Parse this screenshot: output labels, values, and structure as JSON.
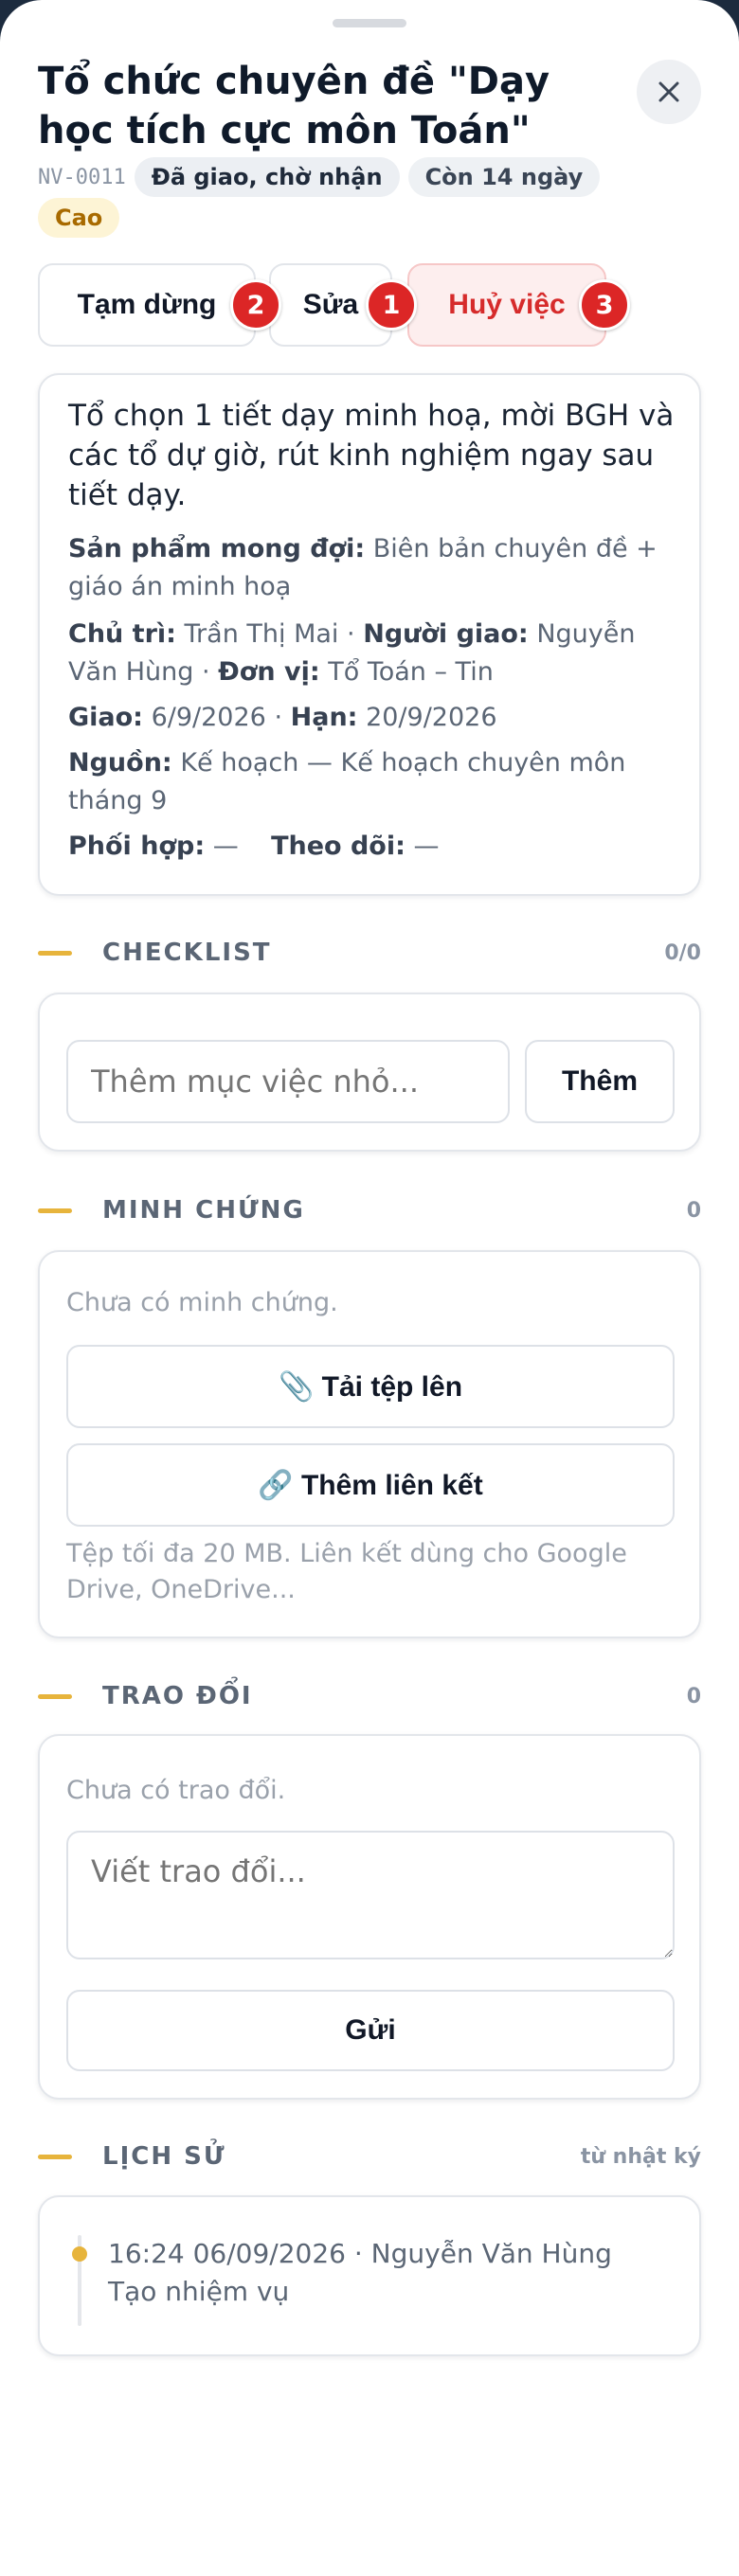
{
  "task": {
    "title": "Tổ chức chuyên đề \"Dạy học tích cực môn Toán\"",
    "code": "NV-0011",
    "status": "Đã giao, chờ nhận",
    "remaining": "Còn 14 ngày",
    "priority": "Cao"
  },
  "actions": {
    "pause": {
      "label": "Tạm dừng",
      "badge": "2"
    },
    "edit": {
      "label": "Sửa",
      "badge": "1"
    },
    "cancel": {
      "label": "Huỷ việc",
      "badge": "3"
    }
  },
  "details": {
    "description": "Tổ chọn 1 tiết dạy minh hoạ, mời BGH và các tổ dự giờ, rút kinh nghiệm ngay sau tiết dạy.",
    "product_label": "Sản phẩm mong đợi:",
    "product_value": "Biên bản chuyên đề + giáo án minh hoạ",
    "owner_label": "Chủ trì:",
    "owner_value": "Trần Thị Mai",
    "assigner_label": "Người giao:",
    "assigner_value": "Nguyễn Văn Hùng",
    "unit_label": "Đơn vị:",
    "unit_value": "Tổ Toán – Tin",
    "assigned_label": "Giao:",
    "assigned_value": "6/9/2026",
    "due_label": "Hạn:",
    "due_value": "20/9/2026",
    "source_label": "Nguồn:",
    "source_value": "Kế hoạch — Kế hoạch chuyên môn tháng 9",
    "collab_label": "Phối hợp:",
    "collab_value": "—",
    "watch_label": "Theo dõi:",
    "watch_value": "—",
    "sep": "·"
  },
  "checklist": {
    "title": "CHECKLIST",
    "count": "0/0",
    "placeholder": "Thêm mục việc nhỏ...",
    "add_label": "Thêm"
  },
  "evidence": {
    "title": "MINH CHỨNG",
    "count": "0",
    "empty": "Chưa có minh chứng.",
    "upload_label": "📎 Tải tệp lên",
    "link_label": "🔗 Thêm liên kết",
    "hint": "Tệp tối đa 20 MB. Liên kết dùng cho Google Drive, OneDrive..."
  },
  "discussion": {
    "title": "TRAO ĐỔI",
    "count": "0",
    "empty": "Chưa có trao đổi.",
    "placeholder": "Viết trao đổi...",
    "send_label": "Gửi"
  },
  "history": {
    "title": "LỊCH SỬ",
    "note": "từ nhật ký",
    "entries": [
      {
        "meta": "16:24 06/09/2026 · Nguyễn Văn Hùng",
        "text": "Tạo nhiệm vụ"
      }
    ]
  },
  "colors": {
    "accent": "#e7b43c",
    "danger": "#dc2626",
    "backdrop": "#1c2b3e"
  }
}
